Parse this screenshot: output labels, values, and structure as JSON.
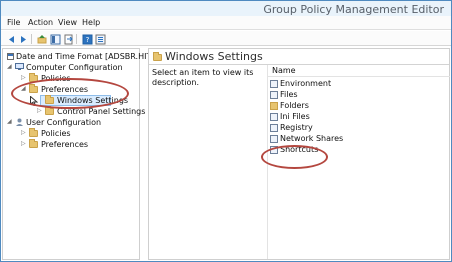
{
  "window": {
    "title": "Group Policy Management Editor"
  },
  "menubar": {
    "items": [
      {
        "label": "File"
      },
      {
        "label": "Action"
      },
      {
        "label": "View"
      },
      {
        "label": "Help"
      }
    ]
  },
  "toolbar": {
    "buttons": [
      {
        "icon": "back-arrow-icon"
      },
      {
        "icon": "forward-arrow-icon"
      },
      {
        "icon": "up-folder-icon"
      },
      {
        "icon": "show-hide-tree-icon"
      },
      {
        "icon": "export-list-icon"
      },
      {
        "icon": "help-icon"
      },
      {
        "icon": "properties-icon"
      }
    ]
  },
  "tree": {
    "root_label": "Date and Time Fomat [ADSBR.HITACHI-",
    "computer_configuration": "Computer Configuration",
    "policies": "Policies",
    "preferences": "Preferences",
    "windows_settings": "Windows Settings",
    "control_panel_settings": "Control Panel Settings",
    "user_configuration": "User Configuration",
    "user_policies": "Policies",
    "user_preferences": "Preferences"
  },
  "right_panel": {
    "title": "Windows Settings",
    "description": "Select an item to view its description.",
    "column_name": "Name",
    "items": [
      {
        "label": "Environment",
        "icon": "environment-icon"
      },
      {
        "label": "Files",
        "icon": "files-icon"
      },
      {
        "label": "Folders",
        "icon": "folder-icon"
      },
      {
        "label": "Ini Files",
        "icon": "ini-files-icon"
      },
      {
        "label": "Registry",
        "icon": "registry-icon"
      },
      {
        "label": "Network Shares",
        "icon": "network-shares-icon"
      },
      {
        "label": "Shortcuts",
        "icon": "shortcut-icon"
      }
    ]
  },
  "annotations": {
    "ellipse_color": "#b4473f"
  },
  "colors": {
    "title_bar": "#e9f3fb",
    "selection": "#d9ecff",
    "selection_border": "#8fbde9"
  }
}
